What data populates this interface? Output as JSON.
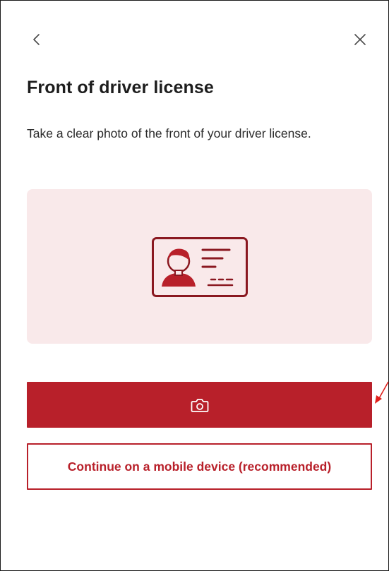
{
  "dialog": {
    "title": "Front of driver license",
    "description": "Take a clear photo of the front of your driver license."
  },
  "nav": {
    "back_icon": "chevron-left-icon",
    "close_icon": "close-icon"
  },
  "illustration": {
    "icon": "driver-license-icon"
  },
  "actions": {
    "take_photo_icon": "camera-icon",
    "mobile_label": "Continue on a mobile device (recommended)"
  },
  "colors": {
    "brand": "#b8202a",
    "illustration_bg": "#f9e9ea",
    "text": "#1d1d1d",
    "annotation": "#e0201c"
  }
}
